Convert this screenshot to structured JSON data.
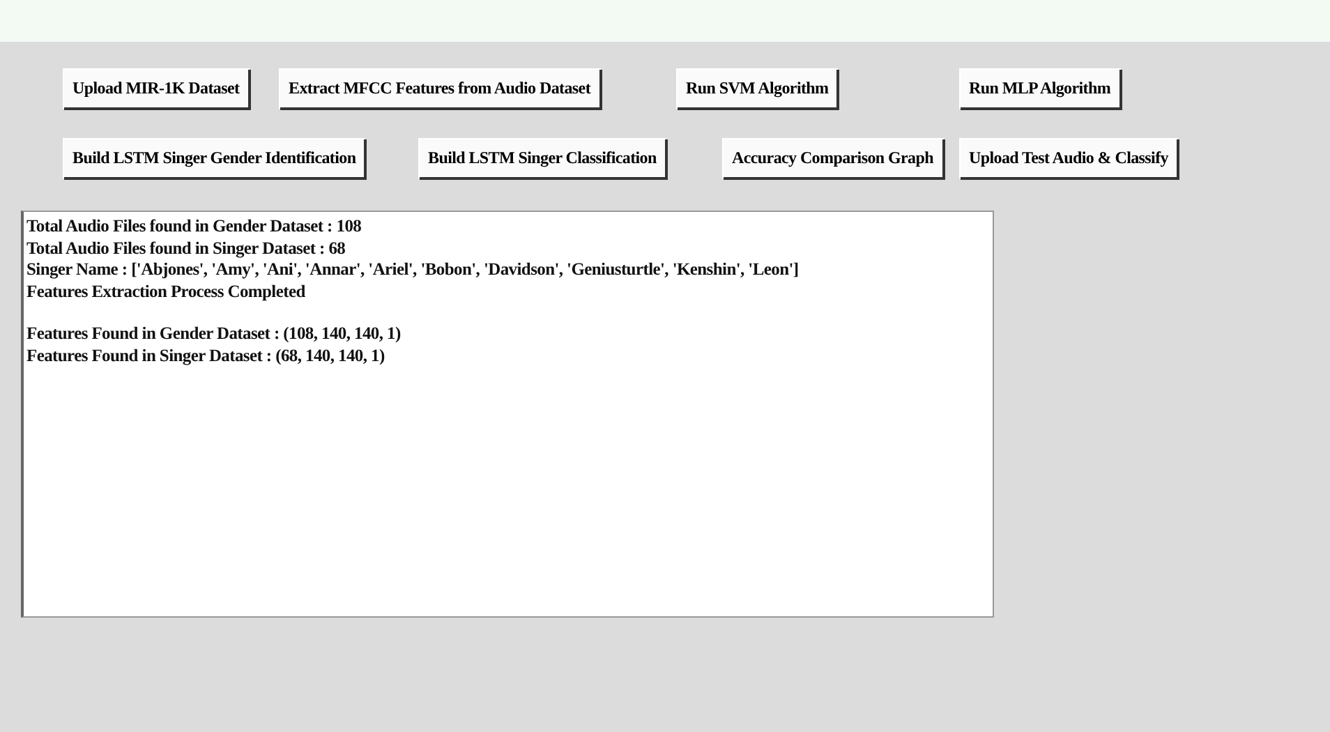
{
  "button_rows": [
    [
      "Upload MIR-1K Dataset",
      "Extract MFCC Features from Audio Dataset",
      "Run SVM Algorithm",
      "Run MLP Algorithm"
    ],
    [
      "Build LSTM Singer Gender Identification",
      "Build LSTM Singer Classification",
      "Accuracy Comparison Graph",
      "Upload Test Audio & Classify"
    ]
  ],
  "output": {
    "paragraphs": [
      [
        "Total Audio Files found in Gender Dataset : 108",
        "Total Audio Files found in Singer Dataset : 68",
        "Singer Name : ['Abjones', 'Amy', 'Ani', 'Annar', 'Ariel', 'Bobon', 'Davidson', 'Geniusturtle', 'Kenshin', 'Leon']",
        "Features Extraction Process Completed"
      ],
      [
        "Features Found in Gender Dataset : (108, 140, 140, 1)",
        "Features Found in Singer Dataset : (68, 140, 140, 1)"
      ]
    ]
  }
}
